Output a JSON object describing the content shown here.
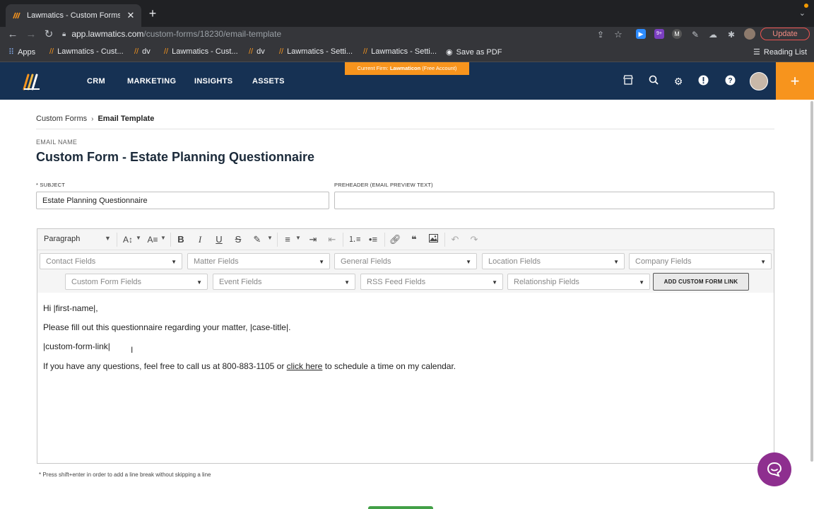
{
  "browser": {
    "tab_title": "Lawmatics - Custom Forms - Email Template",
    "close_glyph": "✕",
    "newtab_glyph": "+",
    "url_host": "app.lawmatics.com",
    "url_path": "/custom-forms/18230/email-template",
    "update_label": "Update",
    "extension_badge": "9+",
    "bookmarks": [
      {
        "label": "Apps"
      },
      {
        "label": "Lawmatics - Cust..."
      },
      {
        "label": "dv"
      },
      {
        "label": "Lawmatics - Cust..."
      },
      {
        "label": "dv"
      },
      {
        "label": "Lawmatics - Setti..."
      },
      {
        "label": "Lawmatics - Setti..."
      },
      {
        "label": "Save as PDF"
      }
    ],
    "reading_list": "Reading List"
  },
  "header": {
    "banner_prefix": "Current Firm: ",
    "banner_firm": "Lawmaticon",
    "banner_suffix": " (Free Account)",
    "menu": [
      "CRM",
      "MARKETING",
      "INSIGHTS",
      "ASSETS"
    ],
    "plus_glyph": "+",
    "brand_color": "#163153",
    "accent_color": "#f7941d"
  },
  "breadcrumb": {
    "parent": "Custom Forms",
    "separator": "›",
    "current": "Email Template"
  },
  "form": {
    "email_name_label": "EMAIL NAME",
    "title": "Custom Form - Estate Planning Questionnaire",
    "subject_label": "* SUBJECT",
    "subject_value": "Estate Planning Questionnaire",
    "preheader_label": "PREHEADER (EMAIL PREVIEW TEXT)",
    "preheader_value": ""
  },
  "editor": {
    "block_format": "Paragraph",
    "field_selects_row1": [
      "Contact Fields",
      "Matter Fields",
      "General Fields",
      "Location Fields",
      "Company Fields"
    ],
    "field_selects_row2": [
      "Custom Form Fields",
      "Event Fields",
      "RSS Feed Fields",
      "Relationship Fields"
    ],
    "add_custom_form_link": "ADD CUSTOM FORM LINK",
    "content": {
      "line1": "Hi |first-name|,",
      "line2": "Please fill out this questionnaire regarding your matter, |case-title|.",
      "line3": "|custom-form-link|",
      "line4_before": "If you have any questions, feel free to call us at 800-883-1105 or ",
      "line4_link": "click here",
      "line4_after": " to schedule a time on my calendar."
    }
  },
  "hint": "* Press shift+enter in order to add a line break without skipping a line"
}
